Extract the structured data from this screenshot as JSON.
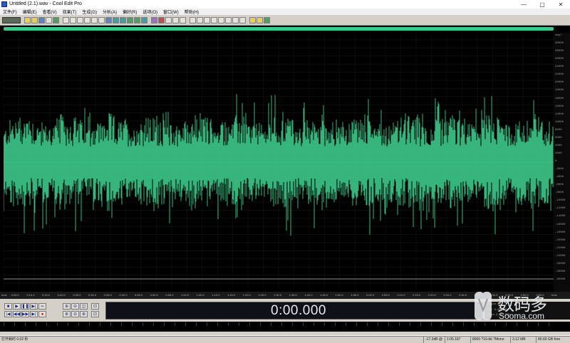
{
  "window": {
    "title": "Untitled (2.1).wav - Cool Edit Pro",
    "minimize": "—",
    "maximize": "▢",
    "close": "✕"
  },
  "menu": [
    "文件(F)",
    "编辑(E)",
    "查看(V)",
    "效果(T)",
    "生成(G)",
    "分析(A)",
    "偏好(R)",
    "选项(O)",
    "窗口(W)",
    "帮助(H)"
  ],
  "amplitude_ruler": [
    "smpl",
    "30000",
    "28000",
    "26000",
    "24000",
    "22000",
    "20000",
    "18000",
    "16000",
    "14000",
    "12000",
    "10000",
    "8000",
    "6000",
    "4000",
    "2000",
    "0",
    "-2000",
    "-4000",
    "-6000",
    "-8000",
    "-10000",
    "-12000",
    "-14000",
    "-16000",
    "-18000",
    "-20000",
    "-22000",
    "-24000",
    "-26000",
    "-28000",
    "-30000"
  ],
  "timeline": [
    "hms",
    "0:05.0",
    "0:10.0",
    "0:15.0",
    "0:20.0",
    "0:25.0",
    "0:30.0",
    "0:35.0",
    "0:40.0",
    "0:45.0",
    "0:50.0",
    "0:55.0",
    "1:00.0",
    "1:05.0",
    "1:10.0",
    "1:15.0",
    "1:20.0",
    "1:25.0",
    "1:30.0",
    "1:35.0",
    "1:40.0",
    "1:45.0",
    "1:50.0",
    "1:55.0",
    "2:00.0",
    "2:05.0",
    "2:10.0",
    "2:15.0",
    "2:20.0",
    "2:25.0",
    "2:30.0",
    "2:35.0",
    "2:40.0",
    "2:45.0",
    "2:50.0",
    "2:55.0",
    "hms"
  ],
  "time_display": "0:00.000",
  "selection": {
    "row1": "Begin    End",
    "row2": "Sel 0:00.000",
    "row3": "View 2:58.718"
  },
  "watermark": {
    "chinese": "数码多",
    "url": "Sooma.com"
  },
  "status": {
    "open_time": "打开耗时  0.02 秒",
    "level": "-17.2dB @",
    "position": "1:05.187",
    "format": "8000 ?16-bit ?Mono",
    "size": "3.12 MB",
    "free": "80.60 GB free"
  },
  "colors": {
    "waveform": "#3ec98a",
    "background": "#000000",
    "accent": "#3ec98a"
  }
}
